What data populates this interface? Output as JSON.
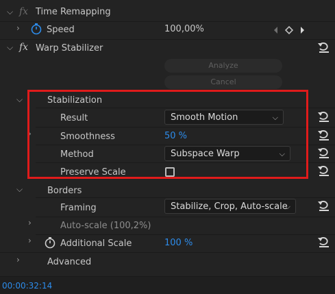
{
  "time_remapping": {
    "fx": "fx",
    "label": "Time Remapping",
    "speed_label": "Speed",
    "speed_value": "100,00%"
  },
  "warp_stabilizer": {
    "fx": "fx",
    "label": "Warp Stabilizer",
    "analyze_label": "Analyze",
    "cancel_label": "Cancel",
    "stabilization": {
      "label": "Stabilization",
      "result_label": "Result",
      "result_value": "Smooth Motion",
      "smoothness_label": "Smoothness",
      "smoothness_value": "50 %",
      "method_label": "Method",
      "method_value": "Subspace Warp",
      "preserve_scale_label": "Preserve Scale",
      "preserve_scale_checked": false
    },
    "borders": {
      "label": "Borders",
      "framing_label": "Framing",
      "framing_value": "Stabilize, Crop, Auto-scale",
      "autoscale_label": "Auto-scale (100,2%)",
      "additional_scale_label": "Additional Scale",
      "additional_scale_value": "100 %"
    },
    "advanced_label": "Advanced"
  },
  "timecode": "00:00:32:14",
  "colors": {
    "accent": "#2d8ceb",
    "highlight": "#e01b1b",
    "background": "#232323"
  },
  "icons": [
    "chevron-right-icon",
    "chevron-down-icon",
    "stopwatch-icon",
    "keyframe-nav-icon",
    "reset-icon",
    "checkbox-icon"
  ]
}
